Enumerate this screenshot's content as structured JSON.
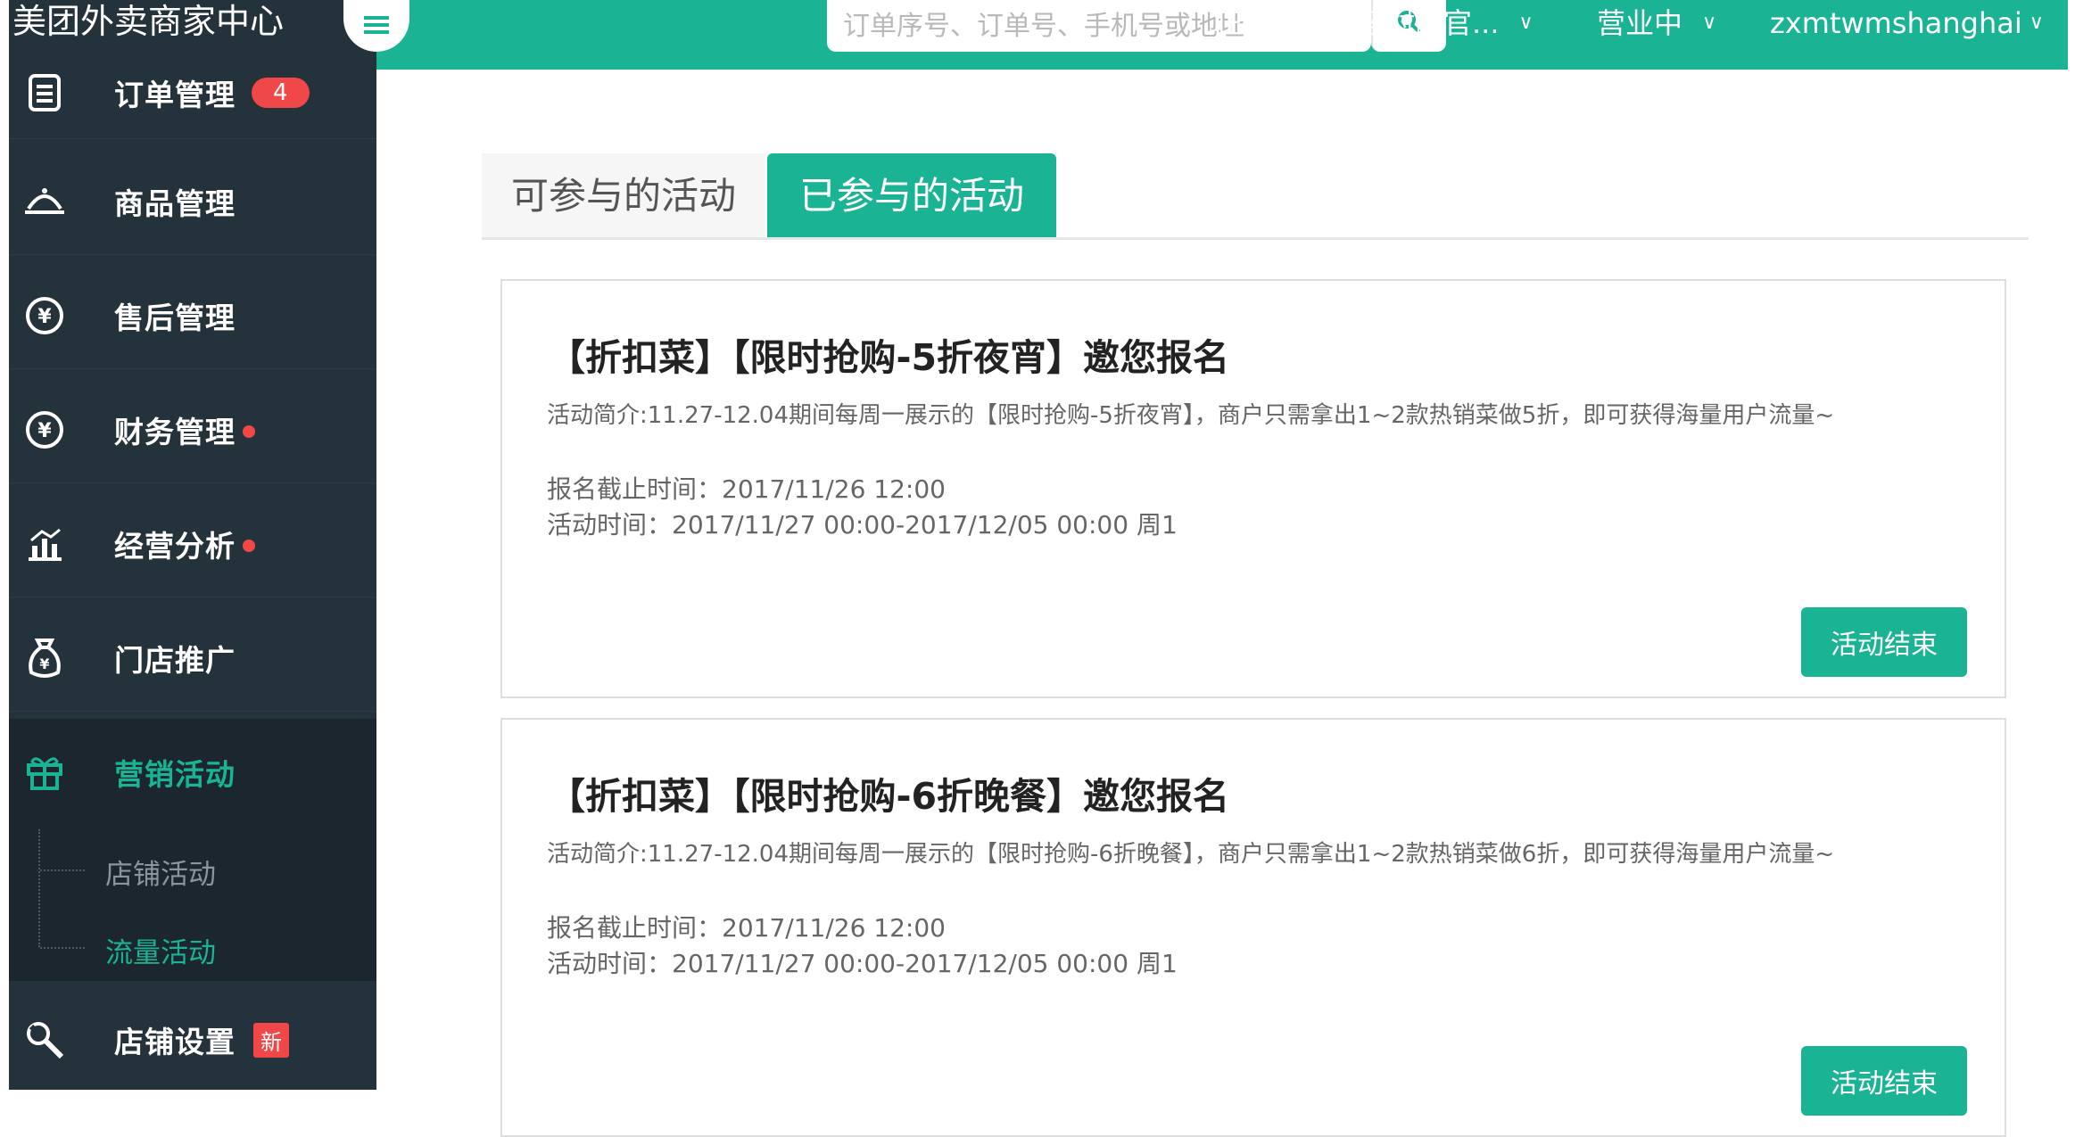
{
  "app": {
    "brand": "美团外卖商家中心"
  },
  "header": {
    "search_placeholder": "订单序号、订单号、手机号或地址",
    "store_name": "正新鸡排（蓝村路官...",
    "status": "营业中",
    "username": "zxmtwmshanghai"
  },
  "sidebar": {
    "items": [
      {
        "label": "订单管理",
        "icon": "order-icon",
        "badge": "4"
      },
      {
        "label": "商品管理",
        "icon": "dish-cover-icon"
      },
      {
        "label": "售后管理",
        "icon": "after-sale-icon"
      },
      {
        "label": "财务管理",
        "icon": "yen-icon"
      },
      {
        "label": "经营分析",
        "icon": "chart-icon"
      },
      {
        "label": "门店推广",
        "icon": "money-bag-icon"
      },
      {
        "label": "营销活动",
        "icon": "gift-icon"
      },
      {
        "label": "店铺设置",
        "icon": "wrench-icon",
        "badge_new": "新"
      }
    ],
    "sub_items": [
      {
        "label": "店铺活动"
      },
      {
        "label": "流量活动"
      }
    ]
  },
  "tabs": [
    {
      "label": "可参与的活动"
    },
    {
      "label": "已参与的活动"
    }
  ],
  "cards": [
    {
      "title": "【折扣菜】【限时抢购-5折夜宵】邀您报名",
      "desc": "活动简介:11.27-12.04期间每周一展示的【限时抢购-5折夜宵】，商户只需拿出1~2款热销菜做5折，即可获得海量用户流量~",
      "deadline": "报名截止时间：2017/11/26 12:00",
      "period": "活动时间：2017/11/27 00:00-2017/12/05 00:00 周1",
      "button": "活动结束"
    },
    {
      "title": "【折扣菜】【限时抢购-6折晚餐】邀您报名",
      "desc": "活动简介:11.27-12.04期间每周一展示的【限时抢购-6折晚餐】，商户只需拿出1~2款热销菜做6折，即可获得海量用户流量~",
      "deadline": "报名截止时间：2017/11/26 12:00",
      "period": "活动时间：2017/11/27 00:00-2017/12/05 00:00 周1",
      "button": "活动结束"
    }
  ],
  "colors": {
    "accent": "#1ab394",
    "sidebar": "#24323c",
    "badge": "#f04848"
  }
}
